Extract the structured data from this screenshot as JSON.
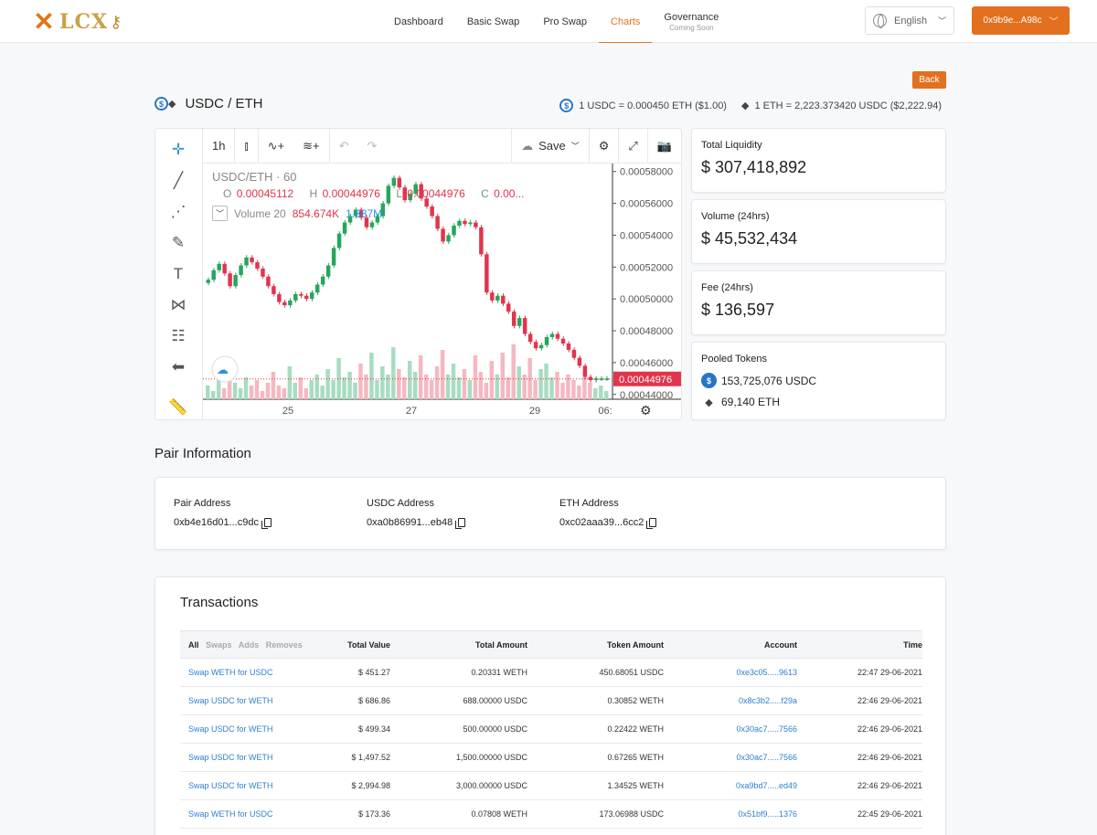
{
  "brand": {
    "name": "LCX"
  },
  "nav": {
    "items": [
      {
        "label": "Dashboard",
        "sub": ""
      },
      {
        "label": "Basic Swap",
        "sub": ""
      },
      {
        "label": "Pro Swap",
        "sub": ""
      },
      {
        "label": "Charts",
        "sub": "",
        "active": true
      },
      {
        "label": "Governance",
        "sub": "Coming Soon"
      }
    ],
    "language": "English",
    "wallet": "0x9b9e...A98c"
  },
  "pair": {
    "title": "USDC / ETH",
    "back_label": "Back",
    "rate_usdc": "1 USDC = 0.000450 ETH ($1.00)",
    "rate_eth": "1 ETH = 2,223.373420 USDC ($2,222.94)"
  },
  "chart": {
    "toolbar": {
      "interval": "1h",
      "save": "Save"
    },
    "legend": {
      "symbol": "USDC/ETH · 60",
      "o_label": "O",
      "o": "0.00045112",
      "h_label": "H",
      "h": "0.00044976",
      "l_label": "L",
      "l": "0.00044976",
      "c_label": "C",
      "c": "0.00...",
      "volume_label": "Volume 20",
      "vol1": "854.674K",
      "vol2": "1.887M"
    },
    "current_price": "0.00044976",
    "colors": {
      "up": "#26a65b",
      "down": "#e0354d",
      "vol_up": "#a8dcc0",
      "vol_down": "#f4b8c0"
    }
  },
  "chart_data": {
    "type": "candlestick",
    "title": "USDC/ETH · 60",
    "x_tick_labels": [
      "25",
      "27",
      "29",
      "06:"
    ],
    "y_tick_labels": [
      "0.00058000",
      "0.00056000",
      "0.00054000",
      "0.00052000",
      "0.00050000",
      "0.00048000",
      "0.00046000",
      "0.00044000"
    ],
    "ylim": [
      0.000437,
      0.000585
    ],
    "close_series": [
      0.000512,
      0.000518,
      0.000522,
      0.000516,
      0.000508,
      0.000515,
      0.000521,
      0.000526,
      0.000523,
      0.000519,
      0.000514,
      0.000508,
      0.000503,
      0.000498,
      0.000496,
      0.000499,
      0.000503,
      0.000502,
      0.0005,
      0.000504,
      0.000509,
      0.000514,
      0.000521,
      0.000532,
      0.000541,
      0.000548,
      0.000552,
      0.000556,
      0.000551,
      0.000545,
      0.000548,
      0.000552,
      0.00056,
      0.000571,
      0.000576,
      0.00057,
      0.000562,
      0.000566,
      0.000572,
      0.000563,
      0.000558,
      0.000552,
      0.000544,
      0.000536,
      0.00054,
      0.000546,
      0.000549,
      0.000547,
      0.000548,
      0.000545,
      0.000528,
      0.000504,
      0.000499,
      0.000502,
      0.000497,
      0.000492,
      0.000483,
      0.000488,
      0.000478,
      0.000473,
      0.000469,
      0.000471,
      0.000476,
      0.000478,
      0.000475,
      0.000472,
      0.000468,
      0.000463,
      0.000458,
      0.000451,
      0.000449,
      0.00045,
      0.00045,
      0.00045
    ],
    "volume_series": [
      5,
      3,
      7,
      4,
      9,
      6,
      4,
      8,
      5,
      7,
      3,
      6,
      10,
      5,
      4,
      12,
      6,
      8,
      4,
      7,
      9,
      5,
      11,
      7,
      15,
      8,
      10,
      6,
      13,
      9,
      17,
      7,
      12,
      9,
      19,
      11,
      8,
      14,
      10,
      16,
      9,
      7,
      12,
      18,
      9,
      13,
      8,
      11,
      7,
      16,
      10,
      6,
      14,
      9,
      17,
      8,
      20,
      12,
      9,
      15,
      7,
      11,
      13,
      8,
      10,
      6,
      9,
      7,
      5,
      8,
      6,
      4,
      5,
      3
    ]
  },
  "stats": {
    "liquidity_label": "Total Liquidity",
    "liquidity": "$ 307,418,892",
    "volume_label": "Volume (24hrs)",
    "volume": "$ 45,532,434",
    "fee_label": "Fee (24hrs)",
    "fee": "$ 136,597",
    "pooled_label": "Pooled Tokens",
    "pooled_usdc": "153,725,076 USDC",
    "pooled_eth": "69,140 ETH"
  },
  "pair_info": {
    "title": "Pair Information",
    "pair_address_label": "Pair Address",
    "pair_address": "0xb4e16d01...c9dc",
    "usdc_address_label": "USDC Address",
    "usdc_address": "0xa0b86991...eb48",
    "eth_address_label": "ETH Address",
    "eth_address": "0xc02aaa39...6cc2"
  },
  "transactions": {
    "title": "Transactions",
    "filters": [
      "All",
      "Swaps",
      "Adds",
      "Removes"
    ],
    "headers": [
      "Total Value",
      "Total Amount",
      "Token Amount",
      "Account",
      "Time"
    ],
    "rows": [
      {
        "action": "Swap WETH for USDC",
        "value": "$ 451.27",
        "total": "0.20331 WETH",
        "token": "450.68051 USDC",
        "account": "0xe3c05.....9613",
        "time": "22:47 29-06-2021"
      },
      {
        "action": "Swap USDC for WETH",
        "value": "$ 686.86",
        "total": "688.00000 USDC",
        "token": "0.30852 WETH",
        "account": "0x8c3b2.....f29a",
        "time": "22:46 29-06-2021"
      },
      {
        "action": "Swap USDC for WETH",
        "value": "$ 499.34",
        "total": "500.00000 USDC",
        "token": "0.22422 WETH",
        "account": "0x30ac7.....7566",
        "time": "22:46 29-06-2021"
      },
      {
        "action": "Swap USDC for WETH",
        "value": "$ 1,497.52",
        "total": "1,500.00000 USDC",
        "token": "0.67265 WETH",
        "account": "0x30ac7.....7566",
        "time": "22:46 29-06-2021"
      },
      {
        "action": "Swap USDC for WETH",
        "value": "$ 2,994.98",
        "total": "3,000.00000 USDC",
        "token": "1.34525 WETH",
        "account": "0xa9bd7.....ed49",
        "time": "22:46 29-06-2021"
      },
      {
        "action": "Swap WETH for USDC",
        "value": "$ 173.36",
        "total": "0.07808 WETH",
        "token": "173.06988 USDC",
        "account": "0x51bf9.....1376",
        "time": "22:45 29-06-2021"
      }
    ]
  }
}
